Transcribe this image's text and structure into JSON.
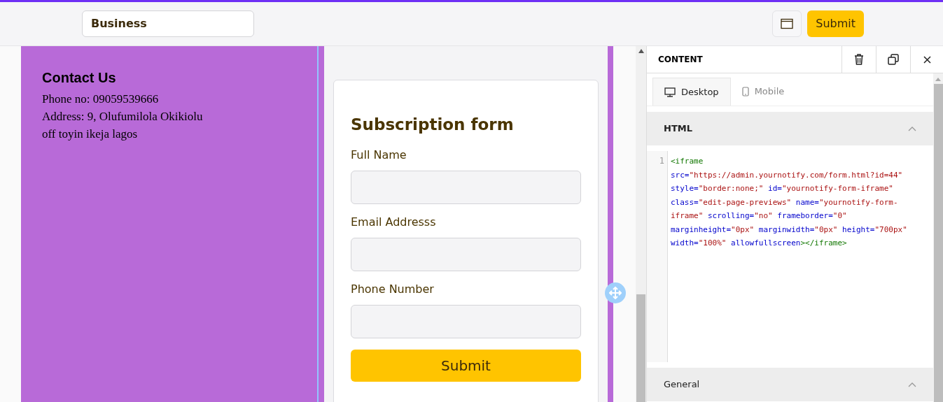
{
  "topbar": {
    "page_name": "Business",
    "submit": "Submit"
  },
  "contact": {
    "title": "Contact Us",
    "lines": [
      "Phone no: 09059539666",
      "Address: 9, Olufumilola Okikiolu",
      "off toyin ikeja lagos"
    ]
  },
  "form": {
    "title": "Subscription form",
    "fields": [
      {
        "label": "Full Name"
      },
      {
        "label": "Email Addresss"
      },
      {
        "label": "Phone Number"
      }
    ],
    "submit": "Submit"
  },
  "panel": {
    "title": "CONTENT",
    "tabs": [
      {
        "label": "Desktop",
        "selected": true,
        "kind": "desktop"
      },
      {
        "label": "Mobile",
        "selected": false,
        "kind": "mobile"
      }
    ],
    "sections": [
      {
        "title": "HTML",
        "expanded": true
      },
      {
        "title": "General",
        "expanded": true
      }
    ],
    "line_number": "1",
    "code": [
      [
        {
          "kind": "tag",
          "text": "<iframe"
        }
      ],
      [
        {
          "kind": "attr",
          "text": "src="
        },
        {
          "kind": "string",
          "text": "\"https://admin.yournotify.com/form.html?id=44\""
        }
      ],
      [
        {
          "kind": "attr",
          "text": "style="
        },
        {
          "kind": "string",
          "text": "\"border:none;\""
        },
        {
          "kind": "attr",
          "text": " id="
        },
        {
          "kind": "string",
          "text": "\"yournotify-form-iframe\""
        }
      ],
      [
        {
          "kind": "attr",
          "text": "class="
        },
        {
          "kind": "string",
          "text": "\"edit-page-previews\""
        },
        {
          "kind": "attr",
          "text": " name="
        },
        {
          "kind": "string",
          "text": "\"yournotify-form-"
        }
      ],
      [
        {
          "kind": "string",
          "text": "iframe\""
        },
        {
          "kind": "attr",
          "text": " scrolling="
        },
        {
          "kind": "string",
          "text": "\"no\""
        },
        {
          "kind": "attr",
          "text": " frameborder="
        },
        {
          "kind": "string",
          "text": "\"0\""
        }
      ],
      [
        {
          "kind": "attr",
          "text": "marginheight="
        },
        {
          "kind": "string",
          "text": "\"0px\""
        },
        {
          "kind": "attr",
          "text": " marginwidth="
        },
        {
          "kind": "string",
          "text": "\"0px\""
        },
        {
          "kind": "attr",
          "text": " height="
        },
        {
          "kind": "string",
          "text": "\"700px\""
        }
      ],
      [
        {
          "kind": "attr",
          "text": "width="
        },
        {
          "kind": "string",
          "text": "\"100%\""
        },
        {
          "kind": "attr",
          "text": " allowfullscreen"
        },
        {
          "kind": "tag",
          "text": "></iframe>"
        }
      ]
    ]
  }
}
